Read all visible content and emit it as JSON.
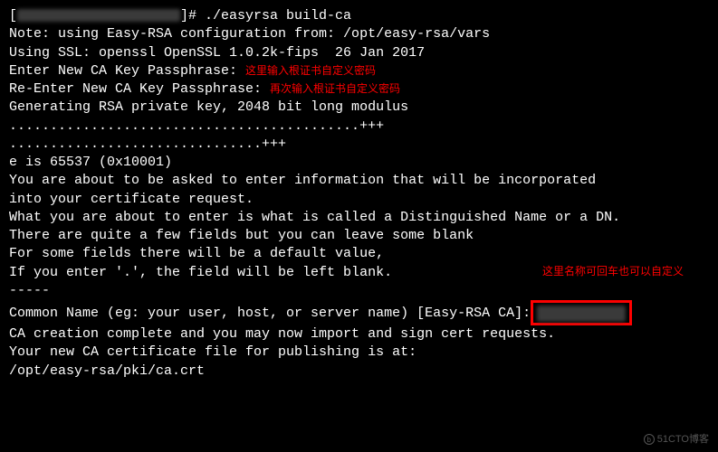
{
  "prompt": {
    "open": "[",
    "host_placeholder": "████████████",
    "close": "]# ",
    "command": "./easyrsa build-ca"
  },
  "lines": {
    "note": "Note: using Easy-RSA configuration from: /opt/easy-rsa/vars",
    "ssl": "Using SSL: openssl OpenSSL 1.0.2k-fips  26 Jan 2017",
    "blank": "",
    "pass1_label": "Enter New CA Key Passphrase: ",
    "pass1_anno": "这里输入根证书自定义密码",
    "pass2_label": "Re-Enter New CA Key Passphrase: ",
    "pass2_anno": "再次输入根证书自定义密码",
    "gen": "Generating RSA private key, 2048 bit long modulus",
    "dots1": "...........................................+++",
    "dots2": "...............................+++",
    "e_line": "e is 65537 (0x10001)",
    "info1": "You are about to be asked to enter information that will be incorporated",
    "info2": "into your certificate request.",
    "info3": "What you are about to enter is what is called a Distinguished Name or a DN.",
    "info4": "There are quite a few fields but you can leave some blank",
    "info5": "For some fields there will be a default value,",
    "info6": "If you enter '.', the field will be left blank.",
    "cn_anno": "这里名称可回车也可以自定义",
    "dashes": "-----",
    "cn_prompt": "Common Name (eg: your user, host, or server name) [Easy-RSA CA]:",
    "cn_input_placeholder": "██████",
    "done1": "CA creation complete and you may now import and sign cert requests.",
    "done2": "Your new CA certificate file for publishing is at:",
    "done3": "/opt/easy-rsa/pki/ca.crt"
  },
  "watermark": "51CTO博客"
}
